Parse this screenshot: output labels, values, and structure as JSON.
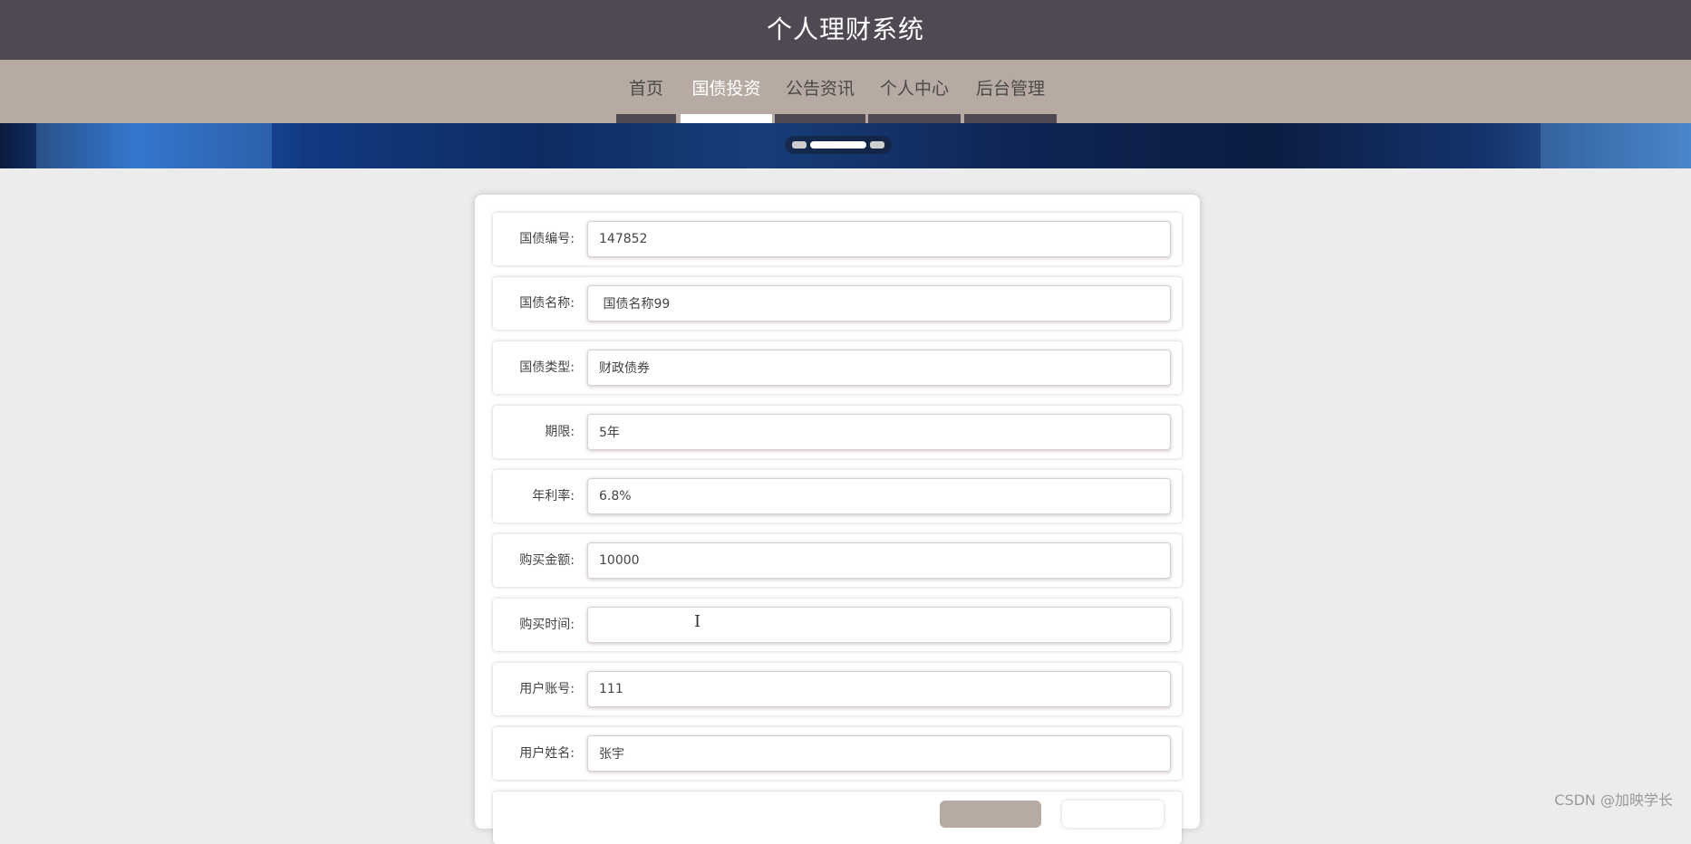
{
  "header": {
    "title": "个人理财系统"
  },
  "nav": {
    "items": [
      {
        "label": "首页",
        "active": false
      },
      {
        "label": "国债投资",
        "active": true
      },
      {
        "label": "公告资讯",
        "active": false
      },
      {
        "label": "个人中心",
        "active": false
      },
      {
        "label": "后台管理",
        "active": false
      }
    ]
  },
  "carousel": {
    "slide_count": 3,
    "active_index": 1
  },
  "form": {
    "fields": [
      {
        "label": "国债编号:",
        "value": "147852"
      },
      {
        "label": "国债名称:",
        "value": " 国债名称99"
      },
      {
        "label": "国债类型:",
        "value": "财政债券"
      },
      {
        "label": "期限:",
        "value": "5年"
      },
      {
        "label": "年利率:",
        "value": "6.8%"
      },
      {
        "label": "购买金额:",
        "value": "10000"
      },
      {
        "label": "购买时间:",
        "value": ""
      },
      {
        "label": "用户账号:",
        "value": "111"
      },
      {
        "label": "用户姓名:",
        "value": "张宇"
      }
    ]
  },
  "watermark": "CSDN @加映学长",
  "colors": {
    "topbar": "#4f4954",
    "navbar": "#b7aaa3",
    "page_bg": "#ececec",
    "active_nav_text": "#ffffff"
  },
  "icons": {
    "text_cursor": "I"
  }
}
